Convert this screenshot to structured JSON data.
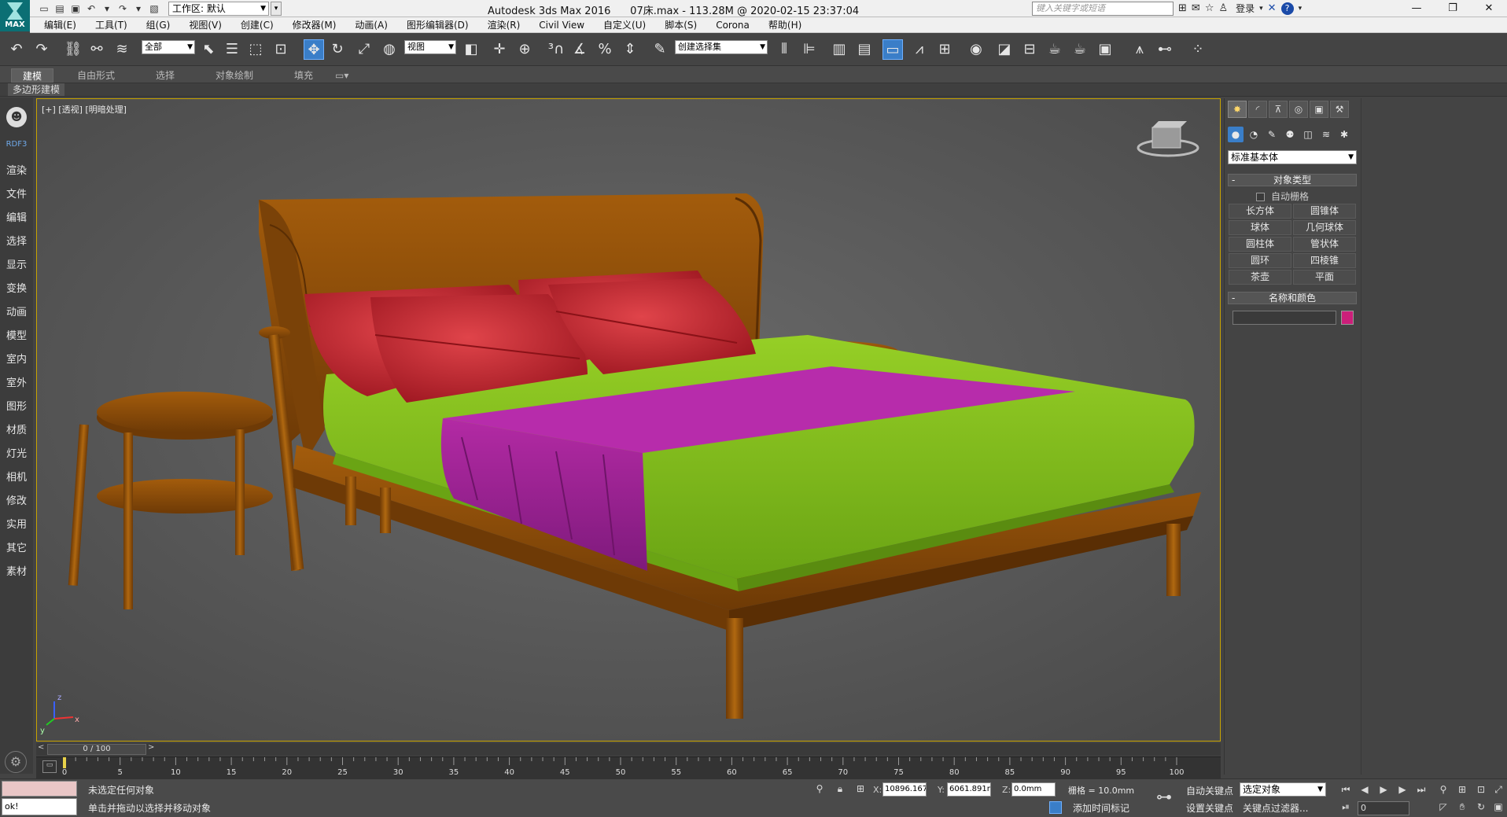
{
  "title_bar": {
    "app_title": "Autodesk 3ds Max 2016      07床.max - 113.28M @ 2020-02-15 23:37:04",
    "logo_text": "MAX",
    "workspace_label": "工作区: 默认",
    "search_placeholder": "键入关键字或短语",
    "login_label": "登录",
    "window_controls": [
      "—",
      "❐",
      "✕"
    ]
  },
  "menu": [
    "编辑(E)",
    "工具(T)",
    "组(G)",
    "视图(V)",
    "创建(C)",
    "修改器(M)",
    "动画(A)",
    "图形编辑器(D)",
    "渲染(R)",
    "Civil View",
    "自定义(U)",
    "脚本(S)",
    "Corona",
    "帮助(H)"
  ],
  "toolbar": {
    "selection_filter": "全部",
    "ref_coord": "视图",
    "named_selection": "创建选择集"
  },
  "ribbon": {
    "tabs": [
      "建模",
      "自由形式",
      "选择",
      "对象绘制",
      "填充"
    ],
    "active_tab": "建模",
    "sub_label": "多边形建模"
  },
  "left_sidebar": {
    "brand": "RDF3",
    "items": [
      "渲染",
      "文件",
      "编辑",
      "选择",
      "显示",
      "变换",
      "动画",
      "模型",
      "室内",
      "室外",
      "图形",
      "材质",
      "灯光",
      "相机",
      "修改",
      "实用",
      "其它",
      "素材"
    ]
  },
  "viewport": {
    "label": "[+] [透视] [明暗处理]",
    "axis_x": "x",
    "axis_y": "y",
    "axis_z": "z"
  },
  "timeline": {
    "slider_label": "0 / 100",
    "ticks": [
      "0",
      "5",
      "10",
      "15",
      "20",
      "25",
      "30",
      "35",
      "40",
      "45",
      "50",
      "55",
      "60",
      "65",
      "70",
      "75",
      "80",
      "85",
      "90",
      "95",
      "100"
    ]
  },
  "command_panel": {
    "primitive_type": "标准基本体",
    "object_type_title": "对象类型",
    "auto_grid_label": "自动栅格",
    "buttons": [
      "长方体",
      "圆锥体",
      "球体",
      "几何球体",
      "圆柱体",
      "管状体",
      "圆环",
      "四棱锥",
      "茶壶",
      "平面"
    ],
    "name_color_title": "名称和颜色",
    "object_color": "#cc1f7a"
  },
  "status_bar": {
    "status_line1": "未选定任何对象",
    "status_line2": "单击并拖动以选择并移动对象",
    "script_input": "ok!",
    "x_label": "X:",
    "x_value": "10896.167",
    "y_label": "Y:",
    "y_value": "6061.891m",
    "z_label": "Z:",
    "z_value": "0.0mm",
    "grid_info": "栅格 = 10.0mm",
    "add_time_tag": "添加时间标记",
    "auto_key": "自动关键点",
    "set_key": "设置关键点",
    "selection_set": "选定对象",
    "key_filters": "关键点过滤器...",
    "current_frame": "0"
  },
  "colors": {
    "viewport_border": "#c8a400",
    "sheet_green": "#86c31a",
    "runner_purple": "#a8239a",
    "pillow_red": "#c8222a",
    "wood_brown": "#8a4a0a"
  }
}
